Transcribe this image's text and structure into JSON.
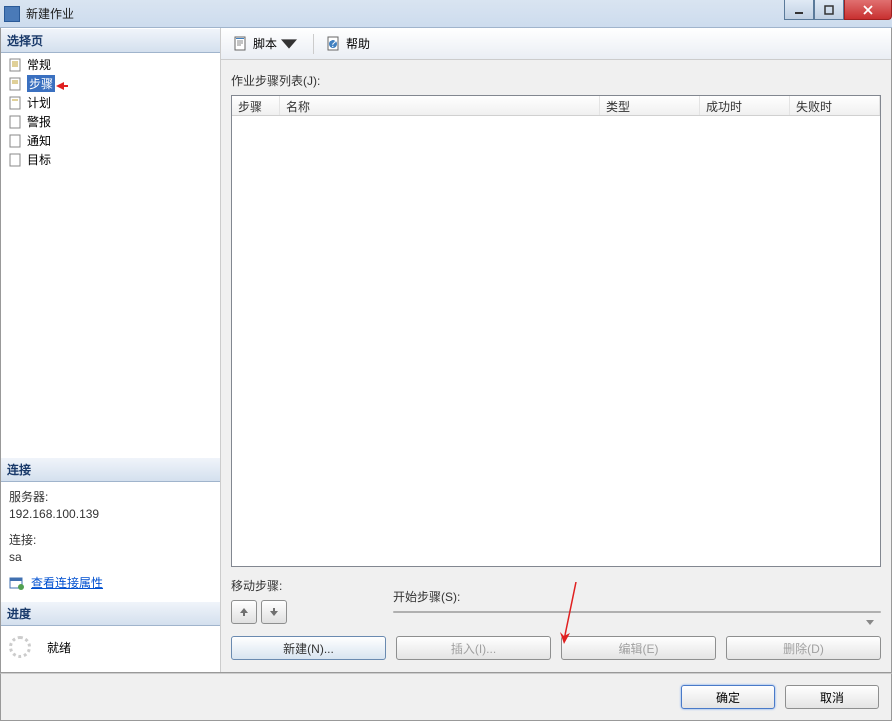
{
  "window": {
    "title": "新建作业"
  },
  "sidebar": {
    "select_page_header": "选择页",
    "items": [
      {
        "label": "常规"
      },
      {
        "label": "步骤"
      },
      {
        "label": "计划"
      },
      {
        "label": "警报"
      },
      {
        "label": "通知"
      },
      {
        "label": "目标"
      }
    ],
    "connection_header": "连接",
    "server_label": "服务器:",
    "server_value": "192.168.100.139",
    "conn_label": "连接:",
    "conn_value": "sa",
    "view_props": "查看连接属性",
    "progress_header": "进度",
    "progress_status": "就绪"
  },
  "toolbar": {
    "script": "脚本",
    "help": "帮助"
  },
  "main": {
    "steps_list_label": "作业步骤列表(J):",
    "columns": {
      "step": "步骤",
      "name": "名称",
      "type": "类型",
      "success": "成功时",
      "fail": "失败时"
    },
    "move_label": "移动步骤:",
    "start_label": "开始步骤(S):",
    "start_value": "",
    "buttons": {
      "new": "新建(N)...",
      "insert": "插入(I)...",
      "edit": "编辑(E)",
      "delete": "删除(D)"
    }
  },
  "footer": {
    "ok": "确定",
    "cancel": "取消"
  }
}
